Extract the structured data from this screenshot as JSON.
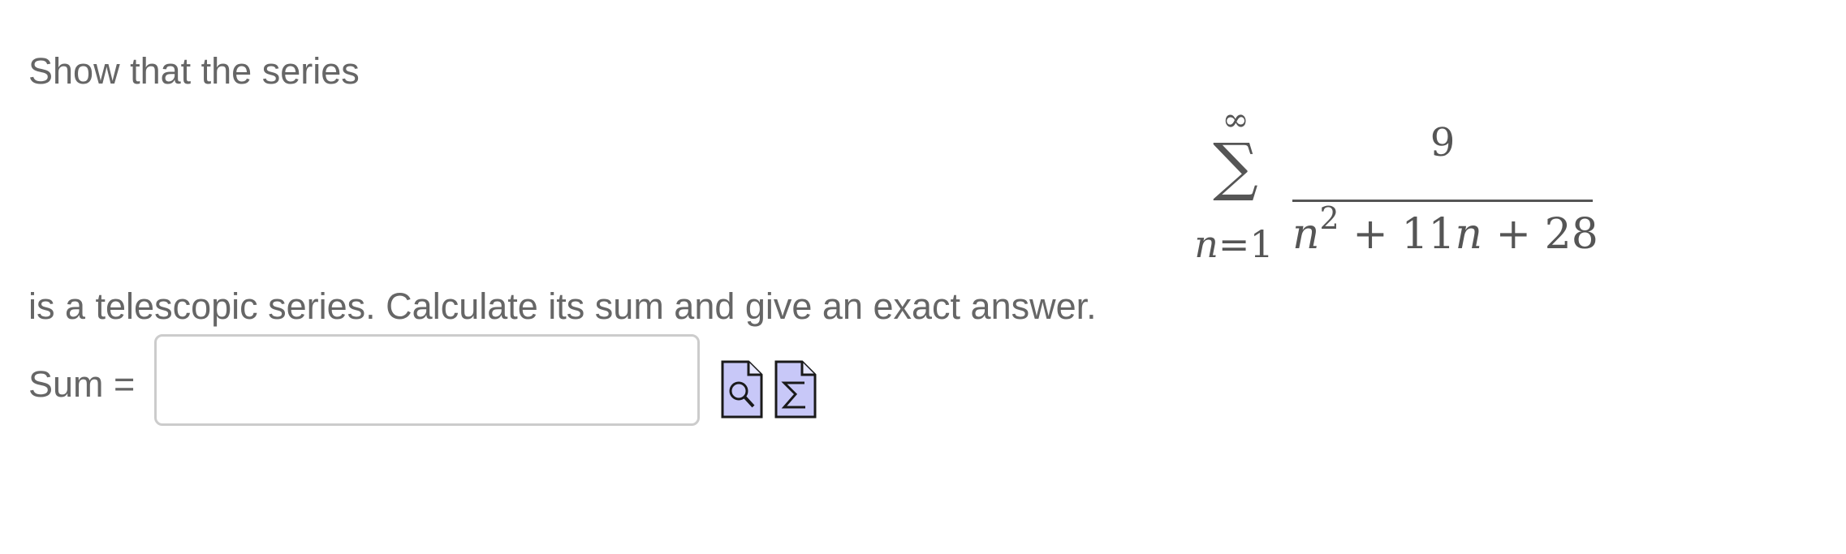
{
  "question": {
    "prompt": "Show that the series",
    "instruction": "is a telescopic series. Calculate its sum and give an exact answer."
  },
  "formula": {
    "sum_upper": "∞",
    "sum_symbol": "∑",
    "sum_lower_var": "n",
    "sum_lower_rest": "=1",
    "numerator": "9",
    "denominator_parts": {
      "var1": "n",
      "exp": "2",
      "mid": " + 11",
      "var2": "n",
      "end": " + 28"
    }
  },
  "answer": {
    "label": "Sum =",
    "value": "",
    "placeholder": ""
  },
  "tools": [
    {
      "name": "preview-answer",
      "icon": "magnifier-document-icon"
    },
    {
      "name": "equation-editor",
      "icon": "sigma-document-icon"
    }
  ],
  "colors": {
    "text": "#666666",
    "icon_fill": "#c8c8f8",
    "icon_stroke": "#1a1a1a",
    "input_border": "#cccccc"
  }
}
